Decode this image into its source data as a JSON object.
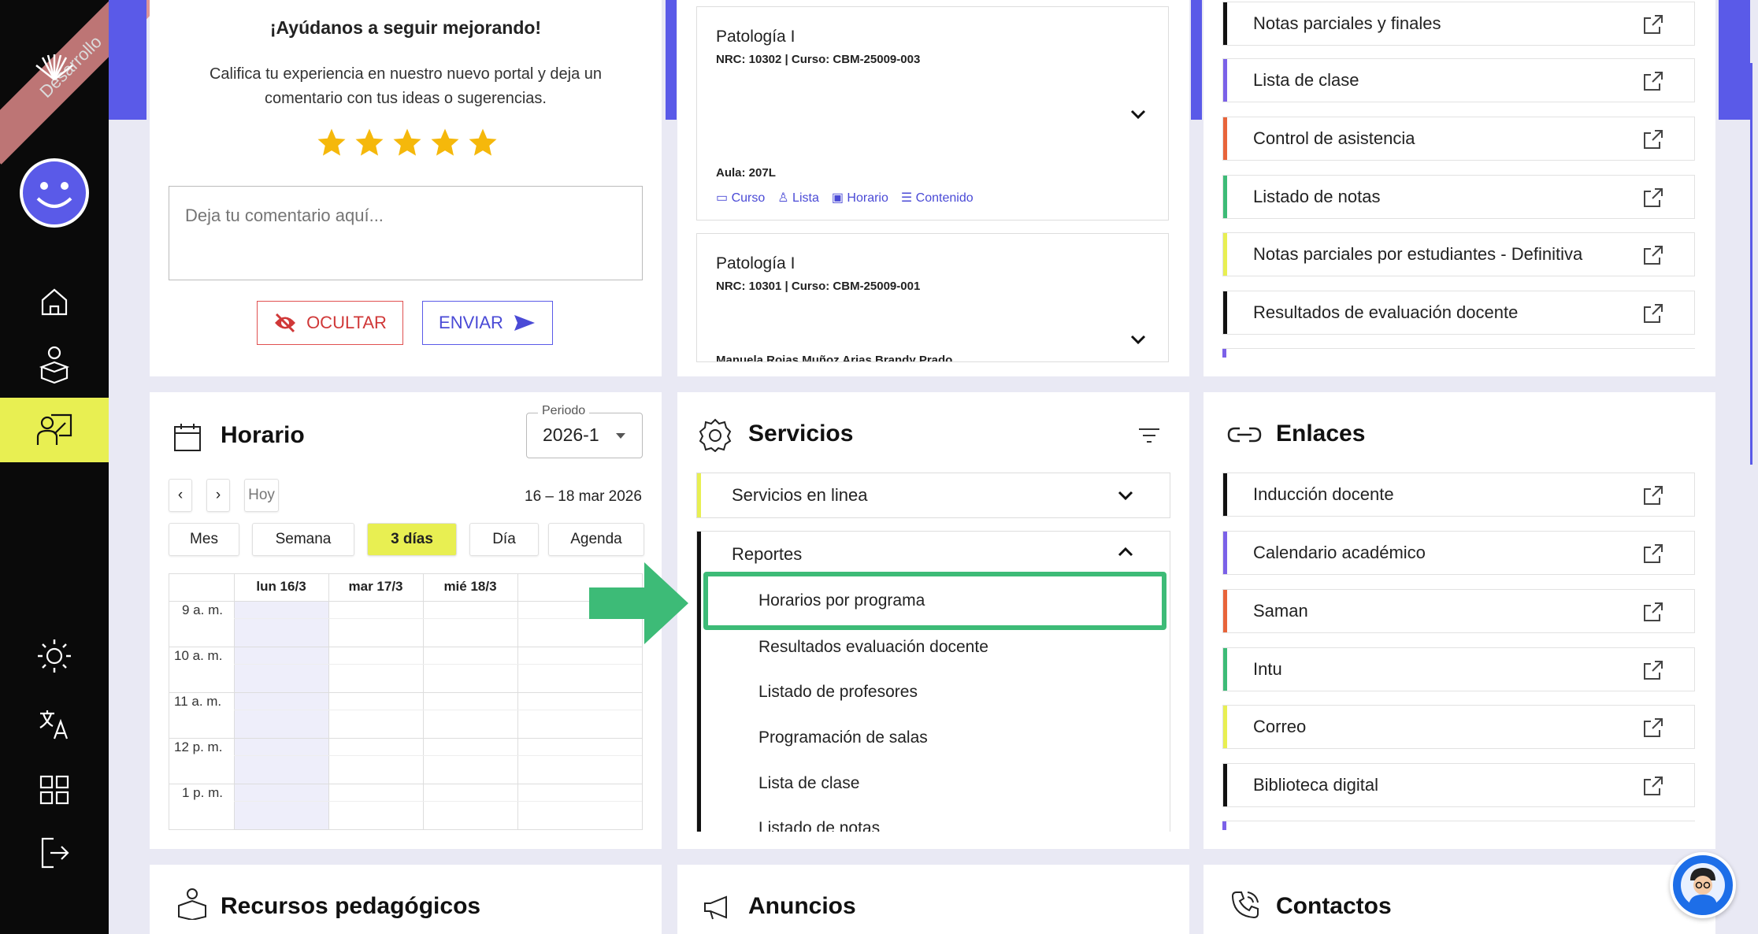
{
  "sidebar": {
    "ribbon": "Desarrollo",
    "icons": [
      "logo-icon",
      "avatar-icon",
      "home-icon",
      "student-icon",
      "teacher-icon",
      "theme-icon",
      "translate-icon",
      "apps-icon",
      "logout-icon"
    ]
  },
  "feedback": {
    "title": "¡Ayúdanos a seguir mejorando!",
    "line1": "Califica tu experiencia en nuestro nuevo portal y deja un",
    "line2": "comentario con tus ideas o sugerencias.",
    "stars": 5,
    "placeholder": "Deja tu comentario aquí...",
    "hide_label": "OCULTAR",
    "send_label": "ENVIAR"
  },
  "courses": [
    {
      "name": "Patología I",
      "meta": "NRC: 10302 | Curso: CBM-25009-003",
      "room": "Aula: 207L",
      "links": [
        "Curso",
        "Lista",
        "Horario",
        "Contenido"
      ]
    },
    {
      "name": "Patología I",
      "meta": "NRC: 10301 | Curso: CBM-25009-001",
      "partial": "Manuela Rojas Muñoz Arias Brandy Prado..."
    }
  ],
  "reports_top": [
    {
      "label": "Notas parciales y finales",
      "color": "#111111"
    },
    {
      "label": "Lista de clase",
      "color": "#7b61e8"
    },
    {
      "label": "Control de asistencia",
      "color": "#e8643a"
    },
    {
      "label": "Listado de notas",
      "color": "#3dbb77"
    },
    {
      "label": "Notas parciales por estudiantes - Definitiva",
      "color": "#e8ef52"
    },
    {
      "label": "Resultados de evaluación docente",
      "color": "#111111"
    }
  ],
  "horario": {
    "title": "Horario",
    "period_label": "Periodo",
    "period_value": "2026-1",
    "today": "Hoy",
    "range": "16 – 18 mar 2026",
    "views": [
      "Mes",
      "Semana",
      "3 días",
      "Día",
      "Agenda"
    ],
    "days": [
      "lun 16/3",
      "mar 17/3",
      "mié 18/3"
    ],
    "times": [
      "9 a. m.",
      "10 a. m.",
      "11 a. m.",
      "12 p. m.",
      "1 p. m."
    ]
  },
  "servicios": {
    "title": "Servicios",
    "online": "Servicios en linea",
    "reportes": "Reportes",
    "items": [
      "Horarios por programa",
      "Resultados evaluación docente",
      "Listado de profesores",
      "Programación de salas",
      "Lista de clase",
      "Listado de notas"
    ]
  },
  "enlaces": {
    "title": "Enlaces",
    "items": [
      {
        "label": "Inducción docente",
        "color": "#111111"
      },
      {
        "label": "Calendario académico",
        "color": "#7b61e8"
      },
      {
        "label": "Saman",
        "color": "#e8643a"
      },
      {
        "label": "Intu",
        "color": "#3dbb77"
      },
      {
        "label": "Correo",
        "color": "#e8ef52"
      },
      {
        "label": "Biblioteca digital",
        "color": "#111111"
      }
    ]
  },
  "bottom": {
    "recursos": "Recursos pedagógicos",
    "anuncios": "Anuncios",
    "contactos": "Contactos"
  },
  "colors": {
    "accent": "#5a5ae8",
    "highlight": "#e8ef52",
    "green": "#3dbb77"
  }
}
